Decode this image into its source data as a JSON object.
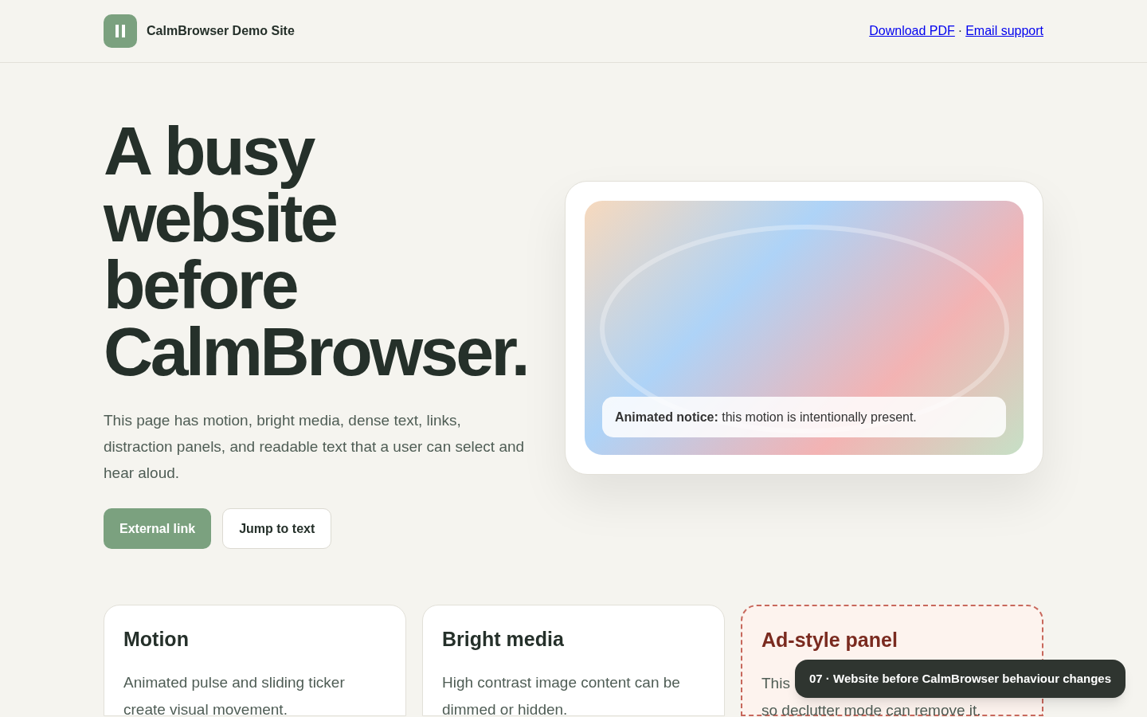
{
  "header": {
    "site_name": "CalmBrowser Demo Site",
    "links": [
      "Download PDF",
      "Email support"
    ],
    "separator": "·"
  },
  "hero": {
    "title": "A busy website before CalmBrowser.",
    "intro": "This page has motion, bright media, dense text, links, distraction panels, and readable text that a user can select and hear aloud.",
    "buttons": [
      {
        "label": "External link",
        "kind": "primary"
      },
      {
        "label": "Jump to text",
        "kind": "secondary"
      }
    ],
    "media": {
      "notice": "**Animated notice:** this motion is intentionally present."
    }
  },
  "cards": [
    {
      "title": "Motion",
      "kind": "normal",
      "lines": [
        "Animated pulse and sliding ticker create visual movement."
      ]
    },
    {
      "title": "Bright media",
      "kind": "normal",
      "lines": [
        "High contrast image content can be dimmed or hidden."
      ]
    },
    {
      "title": "Ad-style panel",
      "kind": "ad",
      "lines": [
        "This",
        "so declutter mode can remove it."
      ]
    }
  ],
  "toast": "07 · Website before CalmBrowser behaviour changes"
}
